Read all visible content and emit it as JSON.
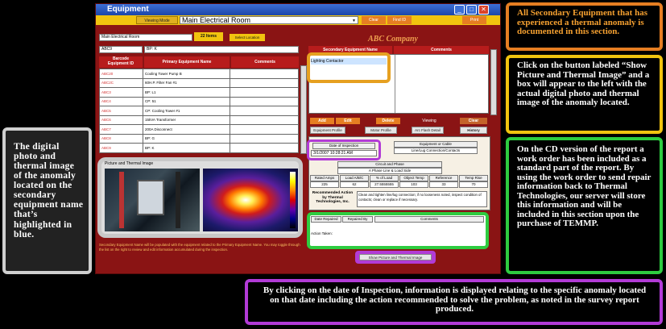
{
  "window": {
    "title": "Equipment",
    "toolbar": {
      "viewing_mode": "Viewing Mode",
      "room": "Main Electrical Room",
      "clear": "Clear",
      "find_id": "Find ID",
      "print": "Print"
    }
  },
  "primary": {
    "room_select": "Main Electrical Room",
    "items_badge": "22 Items",
    "select_location": "Select Location",
    "abc_field": "ABC9",
    "bp_field": "BP: K",
    "headers": [
      "Barcode\nEquipment ID",
      "Primary Equipment Name",
      "Comments"
    ],
    "rows": [
      [
        "ABC20",
        "Cooling Tower Pump B",
        ""
      ],
      [
        "ABC2C",
        "60H.P. Filter Fan #1",
        ""
      ],
      [
        "ABC3",
        "BP: L1",
        ""
      ],
      [
        "ABC4",
        "CP: 51",
        ""
      ],
      [
        "ABC5",
        "CP: Cooling Tower #1",
        ""
      ],
      [
        "ABC6",
        "15kVA Transformer",
        ""
      ],
      [
        "ABC7",
        "200A Disconnect",
        ""
      ],
      [
        "ABC8",
        "BP: G",
        ""
      ],
      [
        "ABC9",
        "BP: K",
        ""
      ]
    ]
  },
  "photo_panel": {
    "title": "Picture and Thermal Image"
  },
  "bottom_note": "Secondary Equipment Name will be populated with the equipment related to the Primary Equipment Name. You may toggle through the list on the right to review and edit information accumulated during the inspection.",
  "secondary": {
    "company": "ABC Company",
    "header_name": "Secondary Equipment Name",
    "header_comments": "Comments",
    "selected_item": "Lighting Contactor",
    "actions": {
      "add": "Add",
      "edit": "Edit",
      "delete": "Delete",
      "viewing": "Viewing",
      "clear": "Clear"
    },
    "tabs": {
      "profile": "Equipment Profile",
      "motor": "Motor Profile",
      "arc": "Arc Flash Detail",
      "history": "History"
    },
    "date_label": "Date of Inspection",
    "date_value": "3/1/2007 10:28:21 AM",
    "equipment_or_cable": "Equipment or Cable",
    "line_lug": "Line/Lug Connection/Contacts",
    "circuit_phase": "Circuit and Phase",
    "phase_value": "A Phase Line & Load Side",
    "measure_labels": [
      "Rated Amps",
      "Load A/B/C",
      "% of Load",
      "Object Temp",
      "Reference",
      "Temp Rise"
    ],
    "measure_values": [
      "225",
      "62",
      "27.5555555",
      "103",
      "33",
      "70"
    ],
    "recommended_label": "Recommended Action by Thermal Technologies, Inc.",
    "recommended_text": "Clean and tighten line/lug connection; if no looseness noted, inspect condition of contacts; clean or replace if necessary.",
    "repair_headers": [
      "Date Repaired",
      "Repaired By",
      "Comments"
    ],
    "action_taken": "Action Taken:",
    "show_picture": "Show Picture and Thermal Image"
  },
  "annotations": {
    "left": "The digital photo and thermal image of the anomaly located on the secondary equipment name that’s highlighted in blue.",
    "top_right": "All Secondary Equipment that has experienced a thermal anomaly is documented in this section.",
    "mid_right": "Click on the button labeled “Show Picture and Thermal Image” and a box will appear to the left with the actual digital photo and thermal image of the anomaly located.",
    "lower_right": "On the CD version of the report a work order has been included as a standard part of the report. By using the work order to send repair information back to Thermal Technologies, our server will store this information and will be included in this section upon the purchase of TEMMP.",
    "bottom": "By clicking on the date of Inspection, information is displayed relating to the specific anomaly located on that date including the action recommended to solve the problem, as noted in the survey report produced."
  },
  "colors": {
    "window_frame": "#8a1414",
    "toolbar": "#f1c40f",
    "orange_box": "#e67e22",
    "yellow_box": "#f1c40f",
    "green_box": "#2ecc40",
    "purple_box": "#b23bd6",
    "left_box": "#3a3a3a"
  }
}
